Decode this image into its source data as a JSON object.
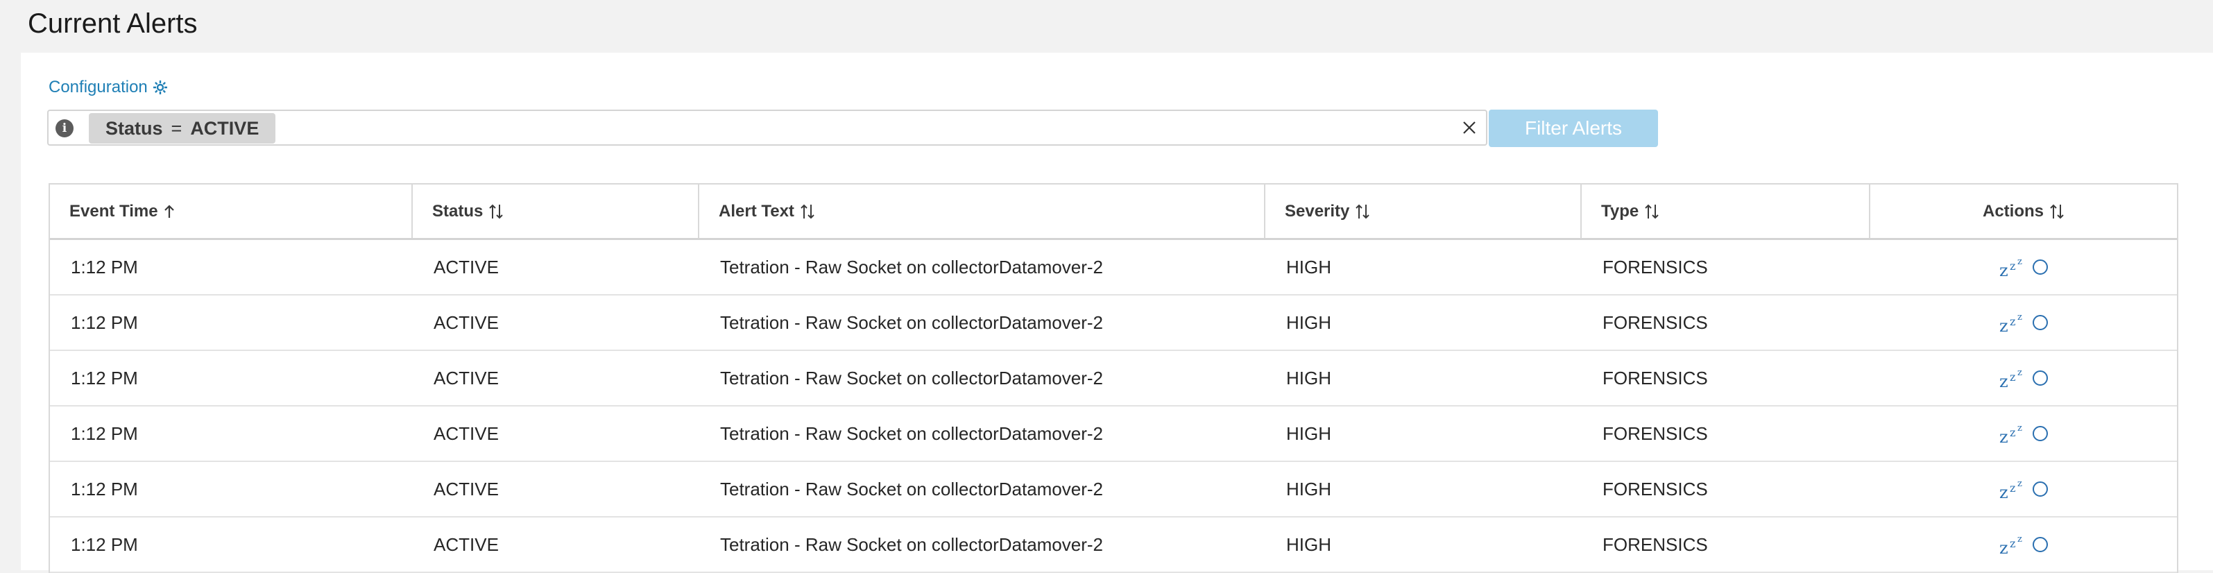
{
  "page": {
    "title": "Current Alerts"
  },
  "config": {
    "label": "Configuration",
    "icon": "gear-icon"
  },
  "filter": {
    "info_icon": "info-icon",
    "info_glyph": "i",
    "chip_field": "Status",
    "chip_operator": "=",
    "chip_value": "ACTIVE",
    "clear_icon": "close-icon",
    "button_label": "Filter Alerts"
  },
  "table": {
    "columns": [
      {
        "label": "Event Time",
        "sort": "ascending"
      },
      {
        "label": "Status",
        "sort": "unsorted"
      },
      {
        "label": "Alert Text",
        "sort": "unsorted"
      },
      {
        "label": "Severity",
        "sort": "unsorted"
      },
      {
        "label": "Type",
        "sort": "unsorted"
      },
      {
        "label": "Actions",
        "sort": "unsorted"
      }
    ],
    "rows": [
      {
        "time": "1:12 PM",
        "status": "ACTIVE",
        "alert_text": "Tetration - Raw Socket on collectorDatamover-2",
        "severity": "HIGH",
        "type": "FORENSICS",
        "actions": [
          "snooze-icon",
          "close-alert-icon"
        ]
      },
      {
        "time": "1:12 PM",
        "status": "ACTIVE",
        "alert_text": "Tetration - Raw Socket on collectorDatamover-2",
        "severity": "HIGH",
        "type": "FORENSICS",
        "actions": [
          "snooze-icon",
          "close-alert-icon"
        ]
      },
      {
        "time": "1:12 PM",
        "status": "ACTIVE",
        "alert_text": "Tetration - Raw Socket on collectorDatamover-2",
        "severity": "HIGH",
        "type": "FORENSICS",
        "actions": [
          "snooze-icon",
          "close-alert-icon"
        ]
      },
      {
        "time": "1:12 PM",
        "status": "ACTIVE",
        "alert_text": "Tetration - Raw Socket on collectorDatamover-2",
        "severity": "HIGH",
        "type": "FORENSICS",
        "actions": [
          "snooze-icon",
          "close-alert-icon"
        ]
      },
      {
        "time": "1:12 PM",
        "status": "ACTIVE",
        "alert_text": "Tetration - Raw Socket on collectorDatamover-2",
        "severity": "HIGH",
        "type": "FORENSICS",
        "actions": [
          "snooze-icon",
          "close-alert-icon"
        ]
      },
      {
        "time": "1:12 PM",
        "status": "ACTIVE",
        "alert_text": "Tetration - Raw Socket on collectorDatamover-2",
        "severity": "HIGH",
        "type": "FORENSICS",
        "actions": [
          "snooze-icon",
          "close-alert-icon"
        ]
      }
    ]
  },
  "colors": {
    "link": "#1f7fb5",
    "button_disabled": "#a8d5ee",
    "action_icon": "#2a6fb0",
    "chip_bg": "#d6d6d6",
    "page_bg": "#f2f2f2"
  }
}
